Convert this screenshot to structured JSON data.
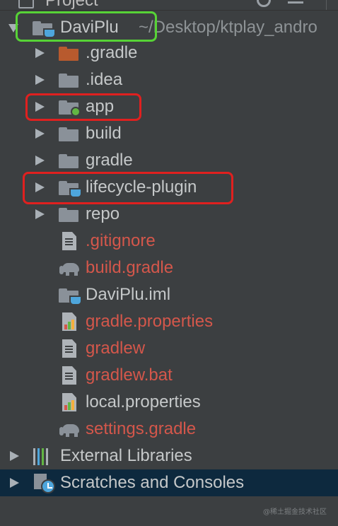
{
  "panel": {
    "title": "Project"
  },
  "root": {
    "name": "DaviPlu",
    "path": "~/Desktop/ktplay_andro"
  },
  "items": [
    {
      "label": "DaviPlu",
      "kind": "module-folder"
    },
    {
      "label": ".gradle",
      "kind": "folder-orange",
      "status": "normal"
    },
    {
      "label": ".idea",
      "kind": "folder",
      "status": "normal"
    },
    {
      "label": "app",
      "kind": "android-module",
      "status": "normal"
    },
    {
      "label": "build",
      "kind": "folder",
      "status": "normal"
    },
    {
      "label": "gradle",
      "kind": "folder",
      "status": "normal"
    },
    {
      "label": "lifecycle-plugin",
      "kind": "module-folder",
      "status": "normal"
    },
    {
      "label": "repo",
      "kind": "folder",
      "status": "normal"
    },
    {
      "label": ".gitignore",
      "kind": "text-file",
      "status": "modified"
    },
    {
      "label": "build.gradle",
      "kind": "gradle-file",
      "status": "modified"
    },
    {
      "label": "DaviPlu.iml",
      "kind": "module-folder",
      "status": "normal"
    },
    {
      "label": "gradle.properties",
      "kind": "properties-file",
      "status": "modified"
    },
    {
      "label": "gradlew",
      "kind": "text-file",
      "status": "modified"
    },
    {
      "label": "gradlew.bat",
      "kind": "text-file",
      "status": "modified"
    },
    {
      "label": "local.properties",
      "kind": "properties-file",
      "status": "normal"
    },
    {
      "label": "settings.gradle",
      "kind": "gradle-file",
      "status": "modified"
    },
    {
      "label": "External Libraries",
      "kind": "libraries",
      "status": "normal"
    },
    {
      "label": "Scratches and Consoles",
      "kind": "scratches",
      "status": "normal"
    }
  ],
  "icons": {
    "expanded": "chevron-down-icon",
    "collapsed": "chevron-right-icon",
    "folder": "folder-icon",
    "module": "module-folder-icon",
    "file": "file-icon",
    "gradle": "gradle-elephant-icon",
    "properties": "properties-file-icon",
    "libraries": "libraries-icon",
    "scratches": "scratches-icon"
  },
  "colors": {
    "background": "#3c3f41",
    "selected_row": "#0d293e",
    "modified_text": "#d4574b",
    "normal_text": "#c5c8c9",
    "highlight_green": "#57d336",
    "highlight_red": "#e0201f"
  },
  "watermark": "@稀土掘金技术社区"
}
